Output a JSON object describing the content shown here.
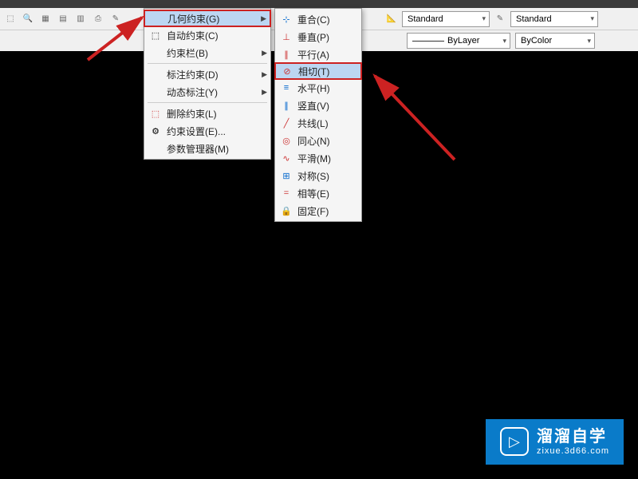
{
  "menus": {
    "main": [
      {
        "label": "几何约束(G)",
        "highlighted": true,
        "arrow": true,
        "icon": ""
      },
      {
        "label": "自动约束(C)",
        "icon": "auto"
      },
      {
        "label": "约束栏(B)",
        "arrow": true
      },
      {
        "sep": true
      },
      {
        "label": "标注约束(D)",
        "arrow": true
      },
      {
        "label": "动态标注(Y)",
        "arrow": true
      },
      {
        "sep": true
      },
      {
        "label": "删除约束(L)",
        "icon": "del"
      },
      {
        "label": "约束设置(E)...",
        "icon": "set"
      },
      {
        "label": "参数管理器(M)"
      }
    ],
    "sub": [
      {
        "label": "重合(C)",
        "icon": "coinc"
      },
      {
        "label": "垂直(P)",
        "icon": "perp"
      },
      {
        "label": "平行(A)",
        "icon": "para"
      },
      {
        "label": "相切(T)",
        "highlighted": true,
        "icon": "tan"
      },
      {
        "label": "水平(H)",
        "icon": "horiz"
      },
      {
        "label": "竖直(V)",
        "icon": "vert"
      },
      {
        "label": "共线(L)",
        "icon": "colin"
      },
      {
        "label": "同心(N)",
        "icon": "conc"
      },
      {
        "label": "平滑(M)",
        "icon": "smooth"
      },
      {
        "label": "对称(S)",
        "icon": "sym"
      },
      {
        "label": "相等(E)",
        "icon": "eq"
      },
      {
        "label": "固定(F)",
        "icon": "fix"
      }
    ]
  },
  "properties": {
    "standard1": "Standard",
    "standard2": "Standard",
    "bylayer": "ByLayer",
    "bycolor": "ByColor"
  },
  "watermark": {
    "title": "溜溜自学",
    "url": "zixue.3d66.com"
  }
}
